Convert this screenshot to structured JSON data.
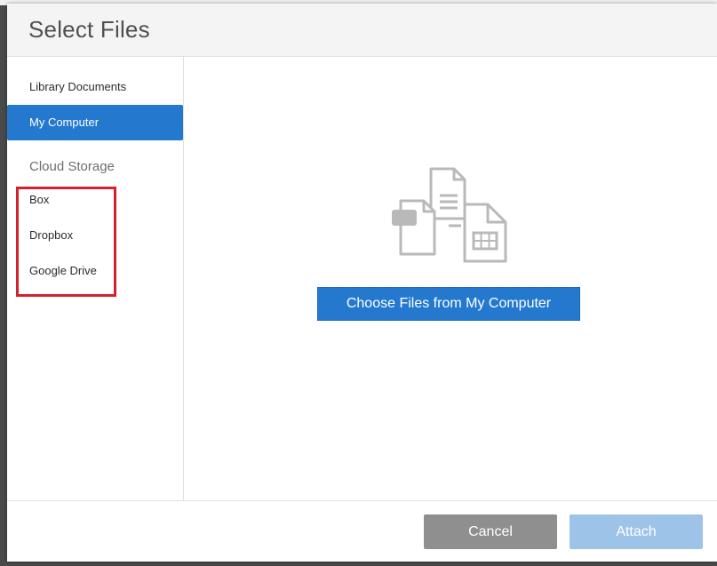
{
  "dialog": {
    "title": "Select Files"
  },
  "sidebar": {
    "items": [
      {
        "label": "Library Documents",
        "active": false
      },
      {
        "label": "My Computer",
        "active": true
      }
    ],
    "cloud_section_label": "Cloud Storage",
    "cloud_items": [
      {
        "label": "Box"
      },
      {
        "label": "Dropbox"
      },
      {
        "label": "Google Drive"
      }
    ]
  },
  "main": {
    "illustration_icon": "files-illustration-icon",
    "choose_button_label": "Choose Files from My Computer"
  },
  "footer": {
    "cancel_label": "Cancel",
    "attach_label": "Attach",
    "attach_enabled": false
  },
  "colors": {
    "accent": "#2479cf",
    "highlight": "#d7202f",
    "cancel_bg": "#8f8f8f",
    "attach_disabled_bg": "#9ec3e8"
  }
}
